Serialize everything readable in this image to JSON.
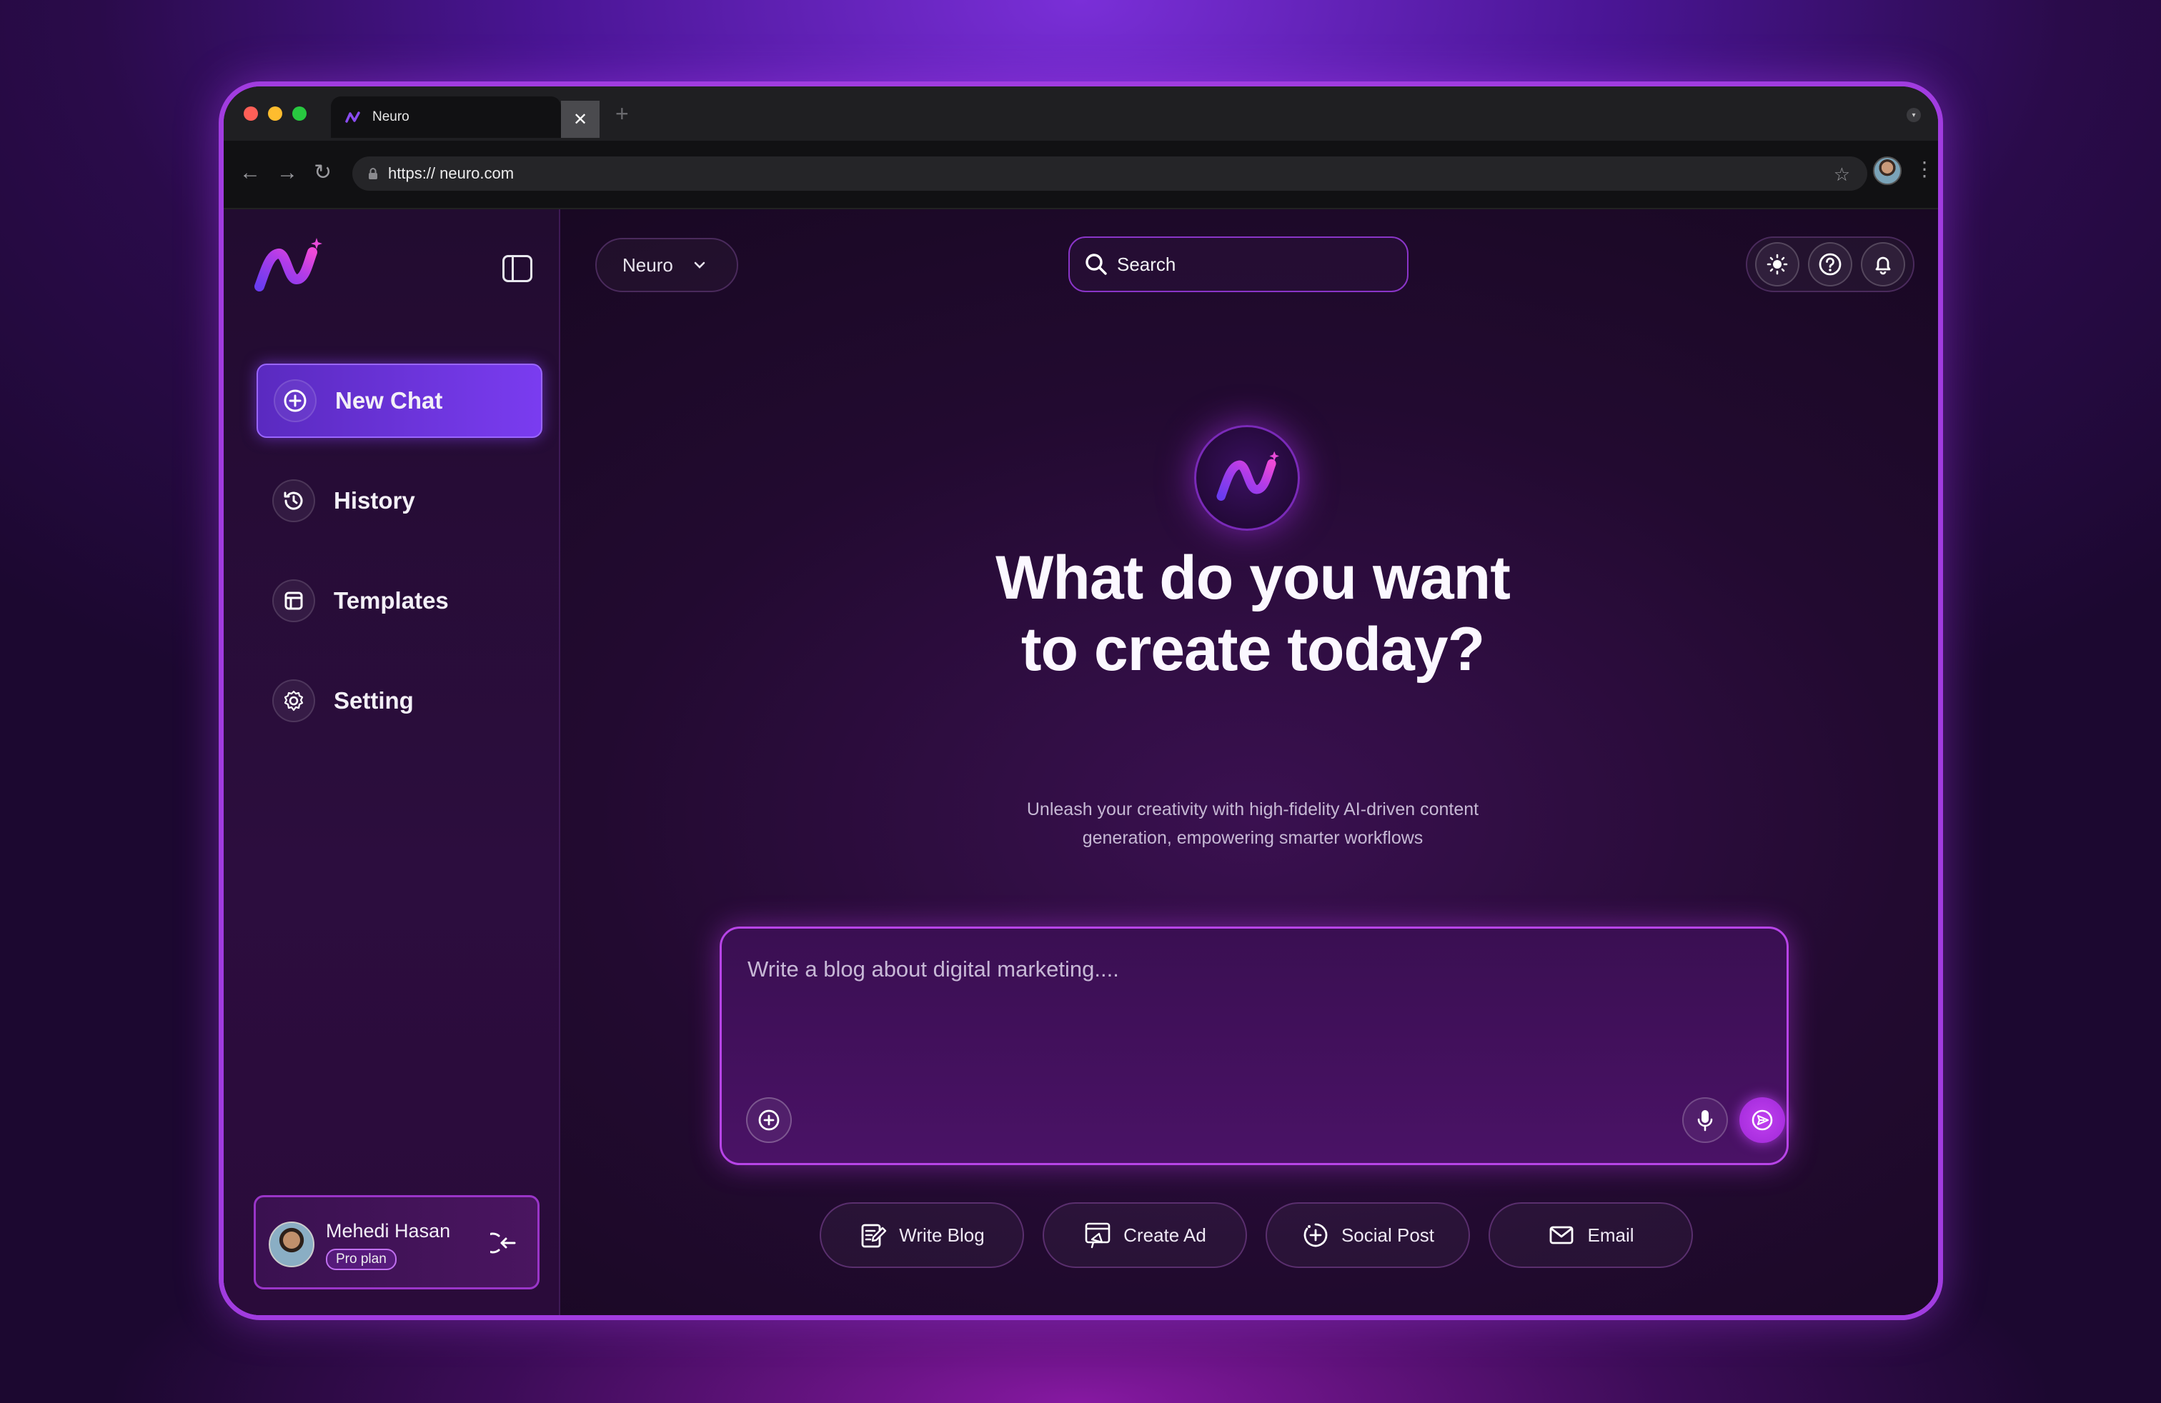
{
  "browser": {
    "tab_title": "Neuro",
    "tab_close": "✕",
    "new_tab": "+",
    "url": "https:// neuro.com"
  },
  "sidebar": {
    "items": [
      {
        "label": "New Chat",
        "icon": "plus-circle-icon",
        "active": true
      },
      {
        "label": "History",
        "icon": "history-icon",
        "active": false
      },
      {
        "label": "Templates",
        "icon": "template-icon",
        "active": false
      },
      {
        "label": "Setting",
        "icon": "gear-icon",
        "active": false
      }
    ],
    "user": {
      "name": "Mehedi Hasan",
      "plan": "Pro plan"
    }
  },
  "header": {
    "model": "Neuro",
    "search_placeholder": "Search"
  },
  "hero": {
    "title": "What do you want to create today?",
    "subtitle": "Unleash your creativity with high-fidelity AI-driven content generation, empowering smarter workflows"
  },
  "prompt": {
    "placeholder": "Write a blog about digital marketing...."
  },
  "quick_actions": [
    {
      "label": "Write Blog",
      "icon": "edit-note-icon"
    },
    {
      "label": "Create Ad",
      "icon": "megaphone-icon"
    },
    {
      "label": "Social Post",
      "icon": "add-post-icon"
    },
    {
      "label": "Email",
      "icon": "mail-icon"
    }
  ],
  "colors": {
    "accent": "#7a3cf0",
    "brand_pink": "#c040f0",
    "background": "#1a0b25"
  }
}
